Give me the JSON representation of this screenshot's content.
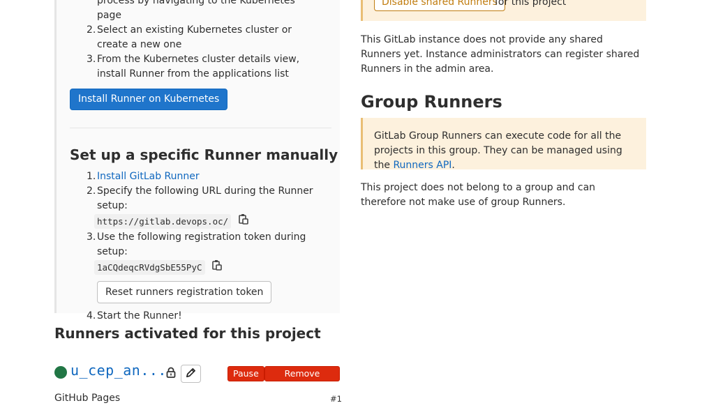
{
  "kubernetes": {
    "steps": [
      "Click the button below to begin the install process by navigating to the Kubernetes page",
      "Select an existing Kubernetes cluster or create a new one",
      "From the Kubernetes cluster details view, install Runner from the applications list"
    ],
    "install_button": "Install Runner on Kubernetes"
  },
  "manual_setup": {
    "title": "Set up a specific Runner manually",
    "step1_link": "Install GitLab Runner",
    "step2_text": "Specify the following URL during the Runner setup:",
    "url": "https://gitlab.devops.oc/",
    "step3_text": "Use the following registration token during setup:",
    "token": "1aCQdeqcRVdgSbE55PyC",
    "reset_button": "Reset runners registration token",
    "step4_text": "Start the Runner!"
  },
  "activated": {
    "title": "Runners activated for this project",
    "runner": {
      "name": "u_cep_an...",
      "description": "GitHub Pages",
      "id": "#1",
      "status_color": "#217645",
      "pause_label": "Pause",
      "remove_label": "Remove Runner"
    }
  },
  "shared": {
    "disable_button": "Disable shared Runners",
    "suffix": "for this project",
    "info": "This GitLab instance does not provide any shared Runners yet. Instance administrators can register shared Runners in the admin area."
  },
  "group": {
    "title": "Group Runners",
    "info_prefix": "GitLab Group Runners can execute code for all the projects in this group. They can be managed using the",
    "info_link": "Runners API",
    "info_suffix": ".",
    "note": "This project does not belong to a group and can therefore not make use of group Runners."
  },
  "colors": {
    "primary": "#1f75cb",
    "danger": "#dd2b0e",
    "warning": "#c17d10",
    "link": "#1068bf"
  },
  "icons": [
    "copy-icon",
    "lock-icon",
    "pencil-icon",
    "status-online-icon"
  ]
}
